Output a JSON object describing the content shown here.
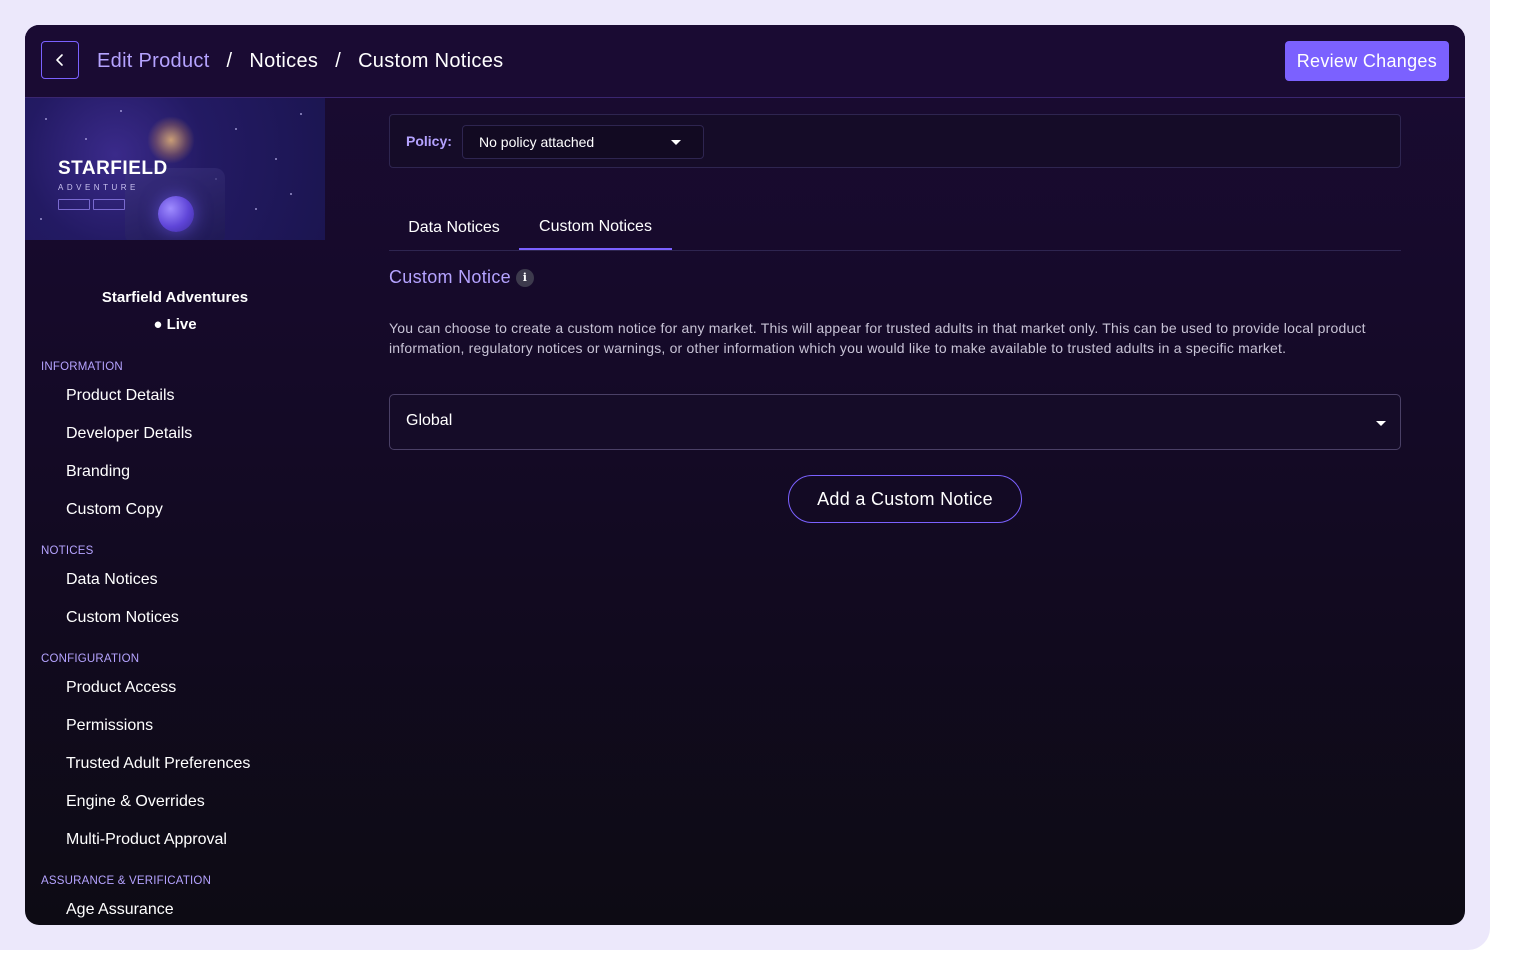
{
  "header": {
    "back_icon": "chevron-left-icon",
    "breadcrumbs": [
      {
        "label": "Edit Product",
        "link": true
      },
      {
        "label": "Notices",
        "link": false
      },
      {
        "label": "Custom Notices",
        "link": false
      }
    ],
    "separator": "/",
    "review_label": "Review Changes"
  },
  "banner": {
    "title": "STARFIELD",
    "subtitle": "ADVENTURE"
  },
  "product": {
    "name": "Starfield Adventures",
    "status": "● Live"
  },
  "sidebar": {
    "sections": [
      {
        "heading": "INFORMATION",
        "items": [
          "Product Details",
          "Developer Details",
          "Branding",
          "Custom Copy"
        ]
      },
      {
        "heading": "NOTICES",
        "items": [
          "Data Notices",
          "Custom Notices"
        ]
      },
      {
        "heading": "CONFIGURATION",
        "items": [
          "Product Access",
          "Permissions",
          "Trusted Adult Preferences",
          "Engine & Overrides",
          "Multi-Product Approval"
        ]
      },
      {
        "heading": "ASSURANCE & VERIFICATION",
        "items": [
          "Age Assurance"
        ]
      }
    ]
  },
  "policy": {
    "label": "Policy:",
    "selected": "No policy attached"
  },
  "tabs": [
    {
      "label": "Data Notices",
      "active": false
    },
    {
      "label": "Custom Notices",
      "active": true
    }
  ],
  "custom_notice": {
    "title": "Custom Notice",
    "info_icon": "info-icon",
    "description": "You can choose to create a custom notice for any market. This will appear for trusted adults in that market only. This can be used to provide local product information, regulatory notices or warnings, or other information which you would like to make available to trusted adults in a specific market.",
    "market_selected": "Global",
    "add_label": "Add a Custom Notice"
  },
  "colors": {
    "accent": "#7b61ff",
    "accent_text": "#b5a3ff",
    "background": "#1a0b33",
    "frame": "#ece8fb"
  }
}
